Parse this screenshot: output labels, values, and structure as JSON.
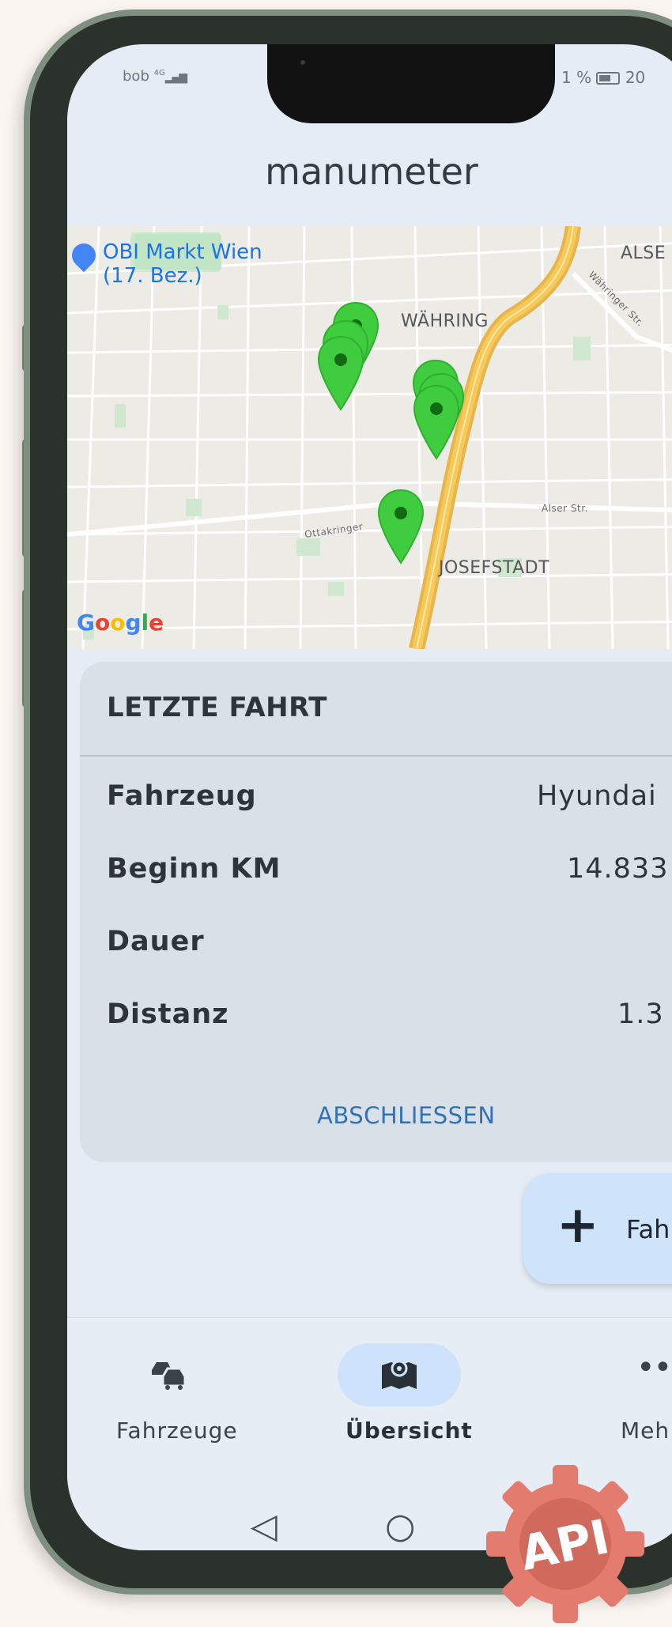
{
  "status_bar": {
    "carrier": "bob",
    "signal": "4G",
    "battery_text": "1 %",
    "time_partial": "20"
  },
  "app": {
    "title": "manumeter"
  },
  "map": {
    "poi_label": "OBI Markt Wien (17. Bez.)",
    "district_1": "WÄHRING",
    "district_2": "JOSEFSTADT",
    "district_3": "ALSE",
    "street_1": "Ottakringer",
    "street_2": "Alser Str.",
    "street_3": "Währinger Str.",
    "attribution": "Google",
    "marker_color": "#3fcc3f"
  },
  "last_trip": {
    "title": "LETZTE FAHRT",
    "rows": [
      {
        "label": "Fahrzeug",
        "value": "Hyundai"
      },
      {
        "label": "Beginn KM",
        "value": "14.833"
      },
      {
        "label": "Dauer",
        "value": ""
      },
      {
        "label": "Distanz",
        "value": "1.3"
      }
    ],
    "close_button": "ABSCHLIESSEN"
  },
  "fab": {
    "label": "Fah"
  },
  "bottom_nav": {
    "items": [
      {
        "label": "Fahrzeuge",
        "icon": "cars-icon"
      },
      {
        "label": "Übersicht",
        "icon": "map-icon"
      },
      {
        "label": "Meh",
        "icon": "more-icon"
      }
    ]
  },
  "badge": {
    "text": "API"
  },
  "colors": {
    "accent": "#2f72b8",
    "nav_pill": "#cee3fb",
    "card_bg": "#dae0e8"
  }
}
